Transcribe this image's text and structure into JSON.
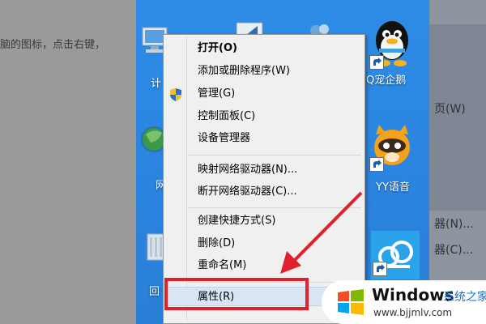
{
  "article": {
    "text_fragment": "脑的图标，点击右键，"
  },
  "right_page_fragments": [
    "页(W)",
    "器(N)...",
    "器(C)..."
  ],
  "desktop": {
    "icons": [
      {
        "label": "计",
        "icon": "computer-icon"
      },
      {
        "label": "网",
        "icon": "network-globe-icon"
      },
      {
        "label": "回",
        "icon": "recycle-bin-icon"
      },
      {
        "label": "Q宠企鹅",
        "icon": "qq-penguin-icon"
      },
      {
        "label": "YY语音",
        "icon": "yy-voice-icon"
      },
      {
        "label": "",
        "icon": "cloud-app-icon"
      }
    ]
  },
  "context_menu": {
    "items": [
      {
        "label": "打开(O)",
        "bold": true
      },
      {
        "label": "添加或删除程序(W)"
      },
      {
        "label": "管理(G)",
        "icon": "uac-shield-icon"
      },
      {
        "label": "控制面板(C)"
      },
      {
        "label": "设备管理器"
      },
      {
        "label": "映射网络驱动器(N)..."
      },
      {
        "label": "断开网络驱动器(C)..."
      },
      {
        "label": "创建快捷方式(S)"
      },
      {
        "label": "删除(D)"
      },
      {
        "label": "重命名(M)"
      },
      {
        "label": "属性(R)",
        "highlighted": true
      }
    ]
  },
  "annotation": {
    "box_color": "#e2202b",
    "arrow_color": "#e2202b"
  },
  "watermark": {
    "brand": "Windows",
    "brand_cn": "系统之家",
    "url": "www.bjjmlv.com"
  },
  "colors": {
    "desktop_blue": "#2e8ce6",
    "menu_bg": "#f0f0f0",
    "highlight": "#d7e5f4"
  }
}
